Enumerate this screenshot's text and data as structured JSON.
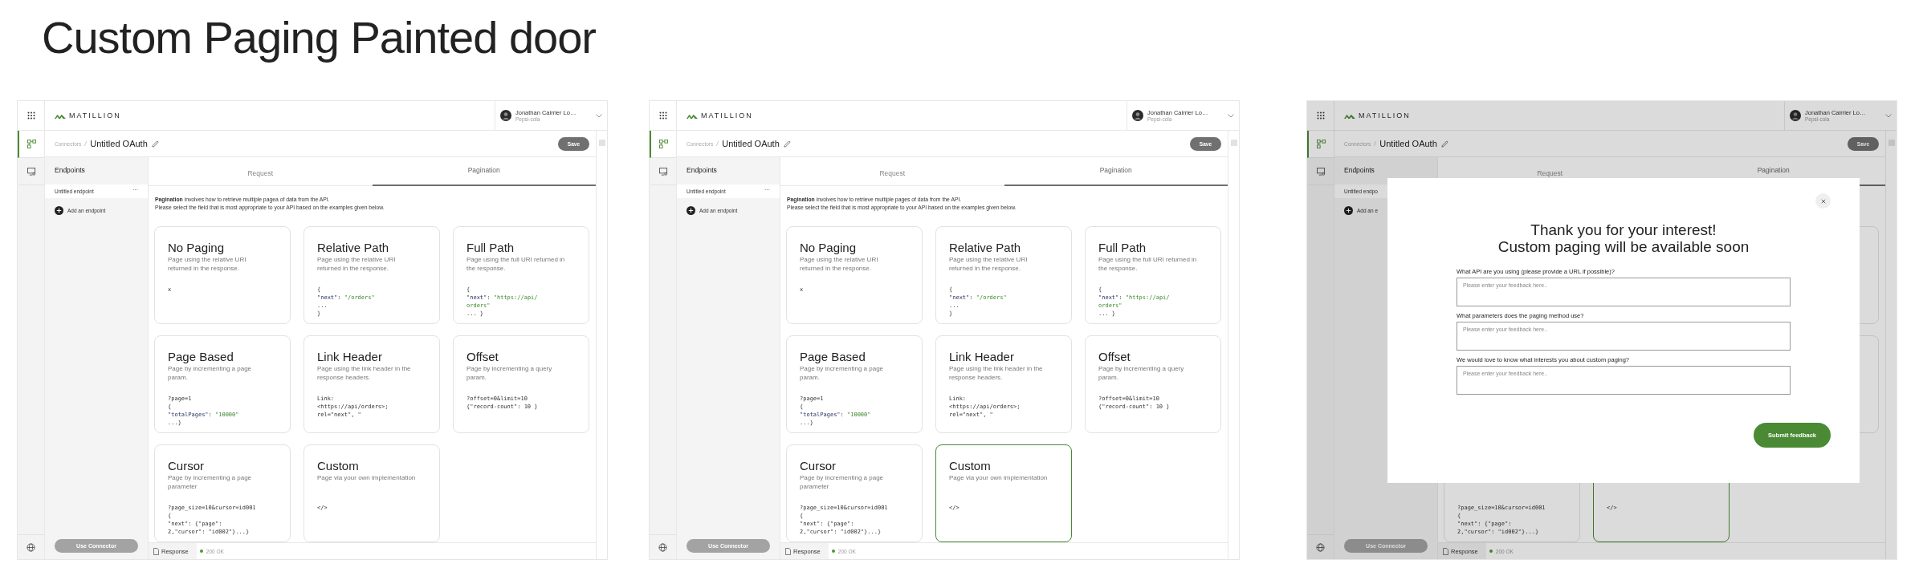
{
  "title": "Custom Paging Painted door",
  "screens": [
    {
      "brand": "MATILLION",
      "user": {
        "name": "Jonathan Cairrier Lo…",
        "org": "Pepsi-cola"
      },
      "breadcrumb": "Connectors",
      "connector_name": "Untitled OAuth",
      "save": "Save",
      "sidebar": {
        "heading": "Endpoints",
        "endpoint": "Untitled endpoint",
        "endpoint_menu": "···",
        "add": "Add an endpoint",
        "use_connector": "Use Connector"
      },
      "tabs": [
        {
          "label": "Request",
          "selected": false
        },
        {
          "label": "Pagination",
          "selected": true
        }
      ],
      "intro": [
        "**Pagination** involves how to retrieve multiple pagea of data from the API.",
        "Please select the field that is most appropriate to your API based on the examples given below."
      ],
      "options": [
        {
          "title": "No Paging",
          "description": "Page using the relative URI returned in the response.",
          "code": [
            [
              {
                "text": "x",
                "kind": "plain"
              }
            ]
          ],
          "selected": false
        },
        {
          "title": "Relative Path",
          "description": "Page using the relative URI returned in the response.",
          "code": [
            [
              {
                "text": "{",
                "kind": "plain"
              }
            ],
            [
              {
                "text": "\"next\"",
                "kind": "key"
              },
              {
                "text": ": ",
                "kind": "plain"
              },
              {
                "text": "\"/orders\"",
                "kind": "string"
              }
            ],
            [
              {
                "text": "...",
                "kind": "plain"
              }
            ],
            [
              {
                "text": "}",
                "kind": "plain"
              }
            ]
          ],
          "selected": false
        },
        {
          "title": "Full Path",
          "description": "Page using the full URI returned in the response.",
          "code": [
            [
              {
                "text": "{",
                "kind": "plain"
              }
            ],
            [
              {
                "text": "\"next\"",
                "kind": "key"
              },
              {
                "text": ": ",
                "kind": "plain"
              },
              {
                "text": "\"https://api/",
                "kind": "string"
              }
            ],
            [
              {
                "text": "orders\"",
                "kind": "string"
              }
            ],
            [
              {
                "text": "... }",
                "kind": "plain"
              }
            ]
          ],
          "selected": false
        },
        {
          "title": "Page Based",
          "description": "Page by incrementing a page param.",
          "code": [
            [
              {
                "text": "?page=1",
                "kind": "plain"
              }
            ],
            [
              {
                "text": "{",
                "kind": "plain"
              }
            ],
            [
              {
                "text": "\"totalPages\"",
                "kind": "key"
              },
              {
                "text": ": ",
                "kind": "plain"
              },
              {
                "text": "\"10000\"",
                "kind": "string"
              }
            ],
            [
              {
                "text": "...}",
                "kind": "plain"
              }
            ]
          ],
          "selected": false
        },
        {
          "title": "Link Header",
          "description": "Page using the link header in the response headers.",
          "code": [
            [
              {
                "text": "Link:",
                "kind": "plain"
              }
            ],
            [
              {
                "text": "<https://api/orders>;",
                "kind": "plain"
              }
            ],
            [
              {
                "text": "rel=\"next\", \"",
                "kind": "plain"
              }
            ]
          ],
          "selected": false
        },
        {
          "title": "Offset",
          "description": "Page by incrementing a query param.",
          "code": [
            [
              {
                "text": "?offset=0&limit=10",
                "kind": "plain"
              }
            ],
            [
              {
                "text": "{\"record-count\": 10 }",
                "kind": "plain"
              }
            ]
          ],
          "selected": false
        },
        {
          "title": "Cursor",
          "description": "Page by incrementing a page parameter",
          "code": [
            [
              {
                "text": "?page_size=10&cursor=id001",
                "kind": "plain"
              }
            ],
            [
              {
                "text": "{",
                "kind": "plain"
              }
            ],
            [
              {
                "text": "\"next\": {\"page\":",
                "kind": "plain"
              }
            ],
            [
              {
                "text": "2,\"cursor\": \"id002\"}...}",
                "kind": "plain"
              }
            ]
          ],
          "selected": false
        },
        {
          "title": "Custom",
          "description": "Page via your own implementation",
          "code": [
            [
              {
                "text": "</>",
                "kind": "plain"
              }
            ]
          ],
          "selected": false
        }
      ],
      "response": {
        "label": "Response",
        "status": "200 OK"
      }
    },
    {
      "brand": "MATILLION",
      "user": {
        "name": "Jonathan Cairrier Lo…",
        "org": "Pepsi-cola"
      },
      "breadcrumb": "Connectors",
      "connector_name": "Untitled OAuth",
      "save": "Save",
      "sidebar": {
        "heading": "Endpoints",
        "endpoint": "Untitled endpoint",
        "endpoint_menu": "···",
        "add": "Add an endpoint",
        "use_connector": "Use Connector"
      },
      "tabs": [
        {
          "label": "Request",
          "selected": false
        },
        {
          "label": "Pagination",
          "selected": true
        }
      ],
      "intro": [
        "**Pagination** involves how to retrieve multiple pages of data from the API.",
        "Please select the field that is most appropriate to your API based on the examples given below."
      ],
      "options": [
        {
          "title": "No Paging",
          "description": "Page using the relative URI returned in the response.",
          "code": [
            [
              {
                "text": "x",
                "kind": "plain"
              }
            ]
          ],
          "selected": false
        },
        {
          "title": "Relative Path",
          "description": "Page using the relative URI returned in the response.",
          "code": [
            [
              {
                "text": "{",
                "kind": "plain"
              }
            ],
            [
              {
                "text": "\"next\"",
                "kind": "key"
              },
              {
                "text": ": ",
                "kind": "plain"
              },
              {
                "text": "\"/orders\"",
                "kind": "string"
              }
            ],
            [
              {
                "text": "...",
                "kind": "plain"
              }
            ],
            [
              {
                "text": "}",
                "kind": "plain"
              }
            ]
          ],
          "selected": false
        },
        {
          "title": "Full Path",
          "description": "Page using the full URI returned in the response.",
          "code": [
            [
              {
                "text": "{",
                "kind": "plain"
              }
            ],
            [
              {
                "text": "\"next\"",
                "kind": "key"
              },
              {
                "text": ": ",
                "kind": "plain"
              },
              {
                "text": "\"https://api/",
                "kind": "string"
              }
            ],
            [
              {
                "text": "orders\"",
                "kind": "string"
              }
            ],
            [
              {
                "text": "... }",
                "kind": "plain"
              }
            ]
          ],
          "selected": false
        },
        {
          "title": "Page Based",
          "description": "Page by incrementing a page param.",
          "code": [
            [
              {
                "text": "?page=1",
                "kind": "plain"
              }
            ],
            [
              {
                "text": "{",
                "kind": "plain"
              }
            ],
            [
              {
                "text": "\"totalPages\"",
                "kind": "key"
              },
              {
                "text": ": ",
                "kind": "plain"
              },
              {
                "text": "\"10000\"",
                "kind": "string"
              }
            ],
            [
              {
                "text": "...}",
                "kind": "plain"
              }
            ]
          ],
          "selected": false
        },
        {
          "title": "Link Header",
          "description": "Page using the link header in the response headers.",
          "code": [
            [
              {
                "text": "Link:",
                "kind": "plain"
              }
            ],
            [
              {
                "text": "<https://api/orders>;",
                "kind": "plain"
              }
            ],
            [
              {
                "text": "rel=\"next\", \"",
                "kind": "plain"
              }
            ]
          ],
          "selected": false
        },
        {
          "title": "Offset",
          "description": "Page by incrementing a query param.",
          "code": [
            [
              {
                "text": "?offset=0&limit=10",
                "kind": "plain"
              }
            ],
            [
              {
                "text": "{\"record-count\": 10 }",
                "kind": "plain"
              }
            ]
          ],
          "selected": false
        },
        {
          "title": "Cursor",
          "description": "Page by incrementing a page parameter",
          "code": [
            [
              {
                "text": "?page_size=10&cursor=id001",
                "kind": "plain"
              }
            ],
            [
              {
                "text": "{",
                "kind": "plain"
              }
            ],
            [
              {
                "text": "\"next\": {\"page\":",
                "kind": "plain"
              }
            ],
            [
              {
                "text": "2,\"cursor\": \"id002\"}...}",
                "kind": "plain"
              }
            ]
          ],
          "selected": false
        },
        {
          "title": "Custom",
          "description": "Page via your own implementation",
          "code": [
            [
              {
                "text": "</>",
                "kind": "plain"
              }
            ]
          ],
          "selected": true
        }
      ],
      "response": {
        "label": "Response",
        "status": "200 OK"
      }
    },
    {
      "brand": "MATILLION",
      "user": {
        "name": "Jonathan Cairrier Lo…",
        "org": "Pepsi-cola"
      },
      "breadcrumb": "Connectors",
      "connector_name": "Untitled OAuth",
      "save": "Save",
      "sidebar": {
        "heading": "Endpoints",
        "endpoint": "Untitled endpo",
        "add": "Add an e",
        "use_connector": "Use Connector"
      },
      "tabs": [
        {
          "label": "Request",
          "selected": false
        },
        {
          "label": "Pagination",
          "selected": true
        }
      ],
      "options": [
        {
          "selected": false
        },
        {
          "selected": false
        },
        {
          "code": [
            [
              {
                "text": "?page_size=10&cursor=id001",
                "kind": "plain"
              }
            ],
            [
              {
                "text": "{",
                "kind": "plain"
              }
            ],
            [
              {
                "text": "\"next\": {\"page\":",
                "kind": "plain"
              }
            ],
            [
              {
                "text": "2,\"cursor\": \"id002\"}...}",
                "kind": "plain"
              }
            ]
          ],
          "selected": false
        },
        {
          "code": [
            [
              {
                "text": "</>",
                "kind": "plain"
              }
            ]
          ],
          "selected": true
        }
      ],
      "response": {
        "label": "Response",
        "status": "200 OK"
      },
      "modal": {
        "heading": [
          "Thank you for your interest!",
          "Custom paging will be available soon"
        ],
        "questions": [
          {
            "label": "What API are you using (please provide a URL if possible)?",
            "placeholder": "Please enter your feedback here.."
          },
          {
            "label": "What parameters does the paging method use?",
            "placeholder": "Please enter your feedback here.."
          },
          {
            "label": "We would love to know what interests you about custom paging?",
            "placeholder": "Please enter your feedback here.."
          }
        ],
        "submit": "Submit feedback"
      }
    }
  ]
}
